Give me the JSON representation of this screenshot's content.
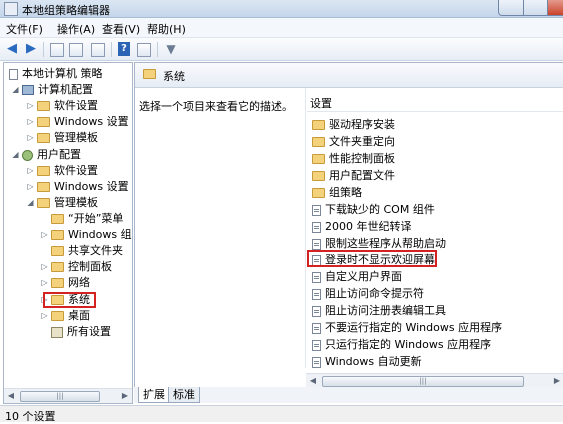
{
  "window": {
    "title": "本地组策略编辑器"
  },
  "menu": [
    "文件(F)",
    "操作(A)",
    "查看(V)",
    "帮助(H)"
  ],
  "toolbar_icons": [
    "back-arrow-icon",
    "forward-arrow-icon",
    "up-folder-icon",
    "show-tree-icon",
    "export-icon",
    "help-icon",
    "properties-icon",
    "filter-icon"
  ],
  "tree": {
    "root": "本地计算机 策略",
    "computer_config": "计算机配置",
    "cc_items": [
      "软件设置",
      "Windows 设置",
      "管理模板"
    ],
    "user_config": "用户配置",
    "uc_items": [
      "软件设置",
      "Windows 设置",
      "管理模板"
    ],
    "templates": [
      "“开始”菜单",
      "Windows 组",
      "共享文件夹",
      "控制面板",
      "网络",
      "系统",
      "桌面",
      "所有设置"
    ]
  },
  "right": {
    "header": "系统",
    "description": "选择一个项目来查看它的描述。",
    "column": "设置",
    "folders": [
      "驱动程序安装",
      "文件夹重定向",
      "性能控制面板",
      "用户配置文件",
      "组策略"
    ],
    "policies": [
      "下载缺少的 COM 组件",
      "2000 年世纪转译",
      "限制这些程序从帮助启动",
      "登录时不显示欢迎屏幕",
      "自定义用户界面",
      "阻止访问命令提示符",
      "阻止访问注册表编辑工具",
      "不要运行指定的 Windows 应用程序",
      "只运行指定的 Windows 应用程序",
      "Windows 自动更新"
    ]
  },
  "tabs": [
    "扩展",
    "标准"
  ],
  "status": "10 个设置",
  "colors": {
    "highlight": "#d42222",
    "folder": "#f3d27b"
  }
}
